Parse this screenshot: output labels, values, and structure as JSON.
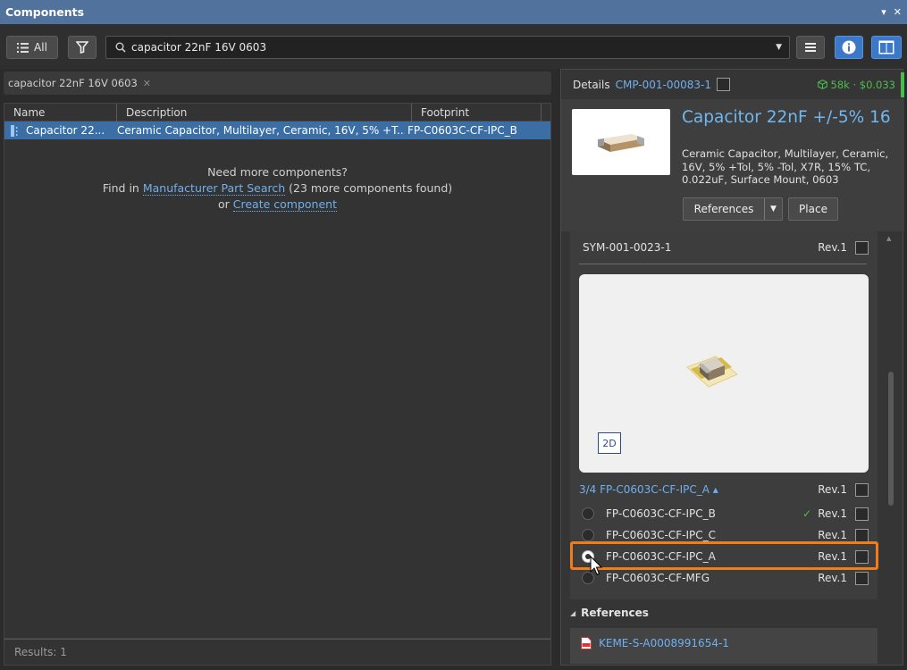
{
  "window": {
    "title": "Components",
    "controls": [
      "▾",
      "✕"
    ]
  },
  "toolbar": {
    "all_label": "All",
    "search_value": "capacitor 22nF 16V 0603"
  },
  "chips": {
    "query": "capacitor 22nF 16V 0603"
  },
  "grid": {
    "columns": [
      "Name",
      "Description",
      "Footprint"
    ],
    "rows": [
      {
        "name": "Capacitor 22...",
        "description": "Ceramic Capacitor, Multilayer, Ceramic, 16V, 5% +T...",
        "footprint": "FP-C0603C-CF-IPC_B"
      }
    ]
  },
  "more": {
    "line1": "Need more components?",
    "find_in": "Find in",
    "mps_link": "Manufacturer Part Search",
    "mps_count": "(23 more components found)",
    "or": "or",
    "create_link": "Create component"
  },
  "results_label": "Results: 1",
  "details": {
    "label": "Details",
    "component_id": "CMP-001-00083-1",
    "price": "58k · $0.033",
    "name": "Capacitor 22nF +/-5% 16",
    "description": "Ceramic Capacitor, Multilayer, Ceramic, 16V, 5% +Tol, 5% -Tol, X7R, 15% TC, 0.022uF, Surface Mount, 0603",
    "references_button": "References",
    "place_button": "Place"
  },
  "models": {
    "symbol": {
      "name": "SYM-001-0023-1",
      "rev": "Rev.1"
    },
    "view_toggle": "2D",
    "footprint_header": {
      "name": "3/4  FP-C0603C-CF-IPC_A ▴",
      "rev": "Rev.1"
    },
    "footprints": [
      {
        "name": "FP-C0603C-CF-IPC_B",
        "rev": "Rev.1",
        "check": "✓"
      },
      {
        "name": "FP-C0603C-CF-IPC_C",
        "rev": "Rev.1",
        "check": ""
      },
      {
        "name": "FP-C0603C-CF-IPC_A",
        "rev": "Rev.1",
        "check": ""
      },
      {
        "name": "FP-C0603C-CF-MFG",
        "rev": "Rev.1",
        "check": ""
      }
    ]
  },
  "references": {
    "section_title": "References",
    "items": [
      "KEME-S-A0008991654-1"
    ]
  },
  "colors": {
    "accent": "#3b78c8",
    "titlebar": "#50729c",
    "highlight": "#f07d1b",
    "link": "#6fb0ee"
  }
}
